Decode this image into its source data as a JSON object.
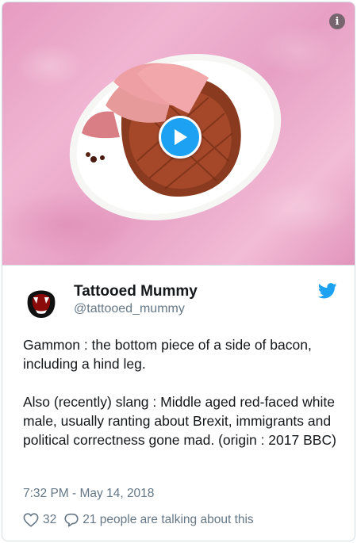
{
  "media": {
    "info_icon": "info-icon",
    "play_icon": "play-icon",
    "accent_color": "#1da1f2"
  },
  "author": {
    "display_name": "Tattooed Mummy",
    "handle": "@tattooed_mummy",
    "avatar_icon": "vampire-mouth-avatar"
  },
  "brand_icon": "twitter-bird-icon",
  "tweet": {
    "paragraph1": "Gammon : the bottom piece of a side of bacon, including a hind leg.",
    "paragraph2": "Also (recently) slang : Middle aged red-faced white male, usually ranting about Brexit, immigrants and political correctness gone mad. (origin : 2017 BBC)",
    "timestamp": "7:32 PM - May 14, 2018"
  },
  "actions": {
    "like_icon": "heart-icon",
    "like_count": "32",
    "reply_icon": "speech-bubble-icon",
    "talking_text": "21 people are talking about this"
  }
}
